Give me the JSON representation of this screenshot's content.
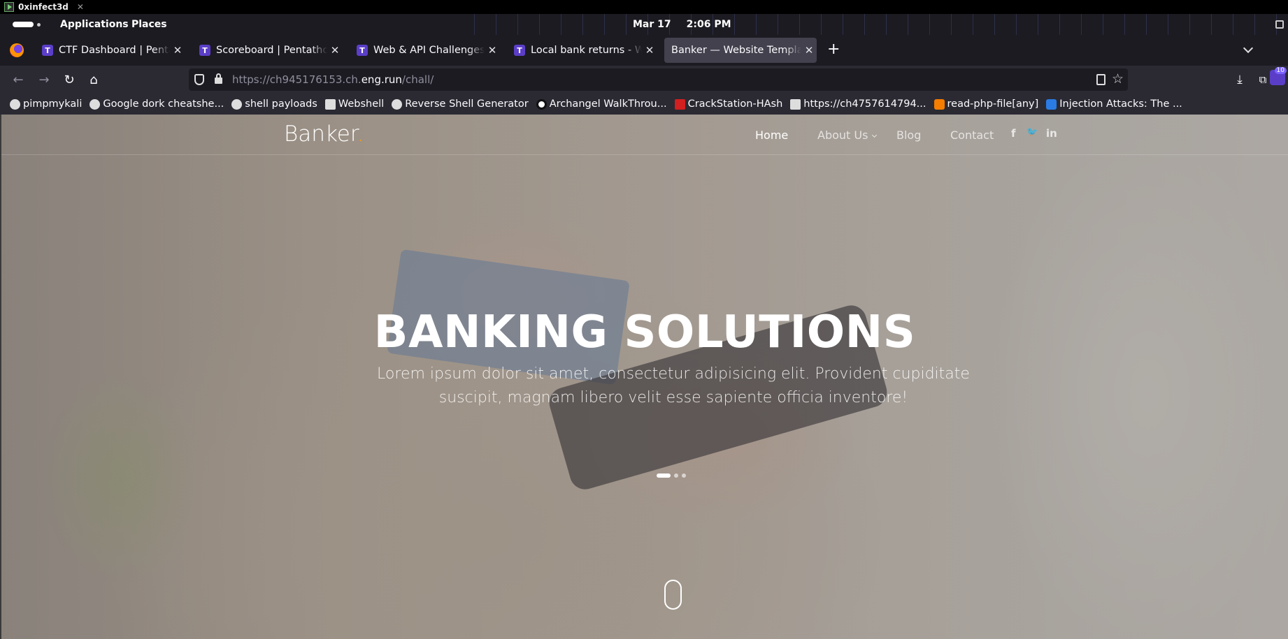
{
  "window": {
    "title": "0xinfect3d",
    "close": "✕"
  },
  "panel": {
    "applications": "Applications",
    "places": "Places",
    "date": "Mar 17",
    "time": "2:06 PM"
  },
  "tabs": [
    {
      "label": "CTF Dashboard | Pentathon",
      "icon": "T"
    },
    {
      "label": "Scoreboard | Pentathon CTF",
      "icon": "T"
    },
    {
      "label": "Web & API Challenges | Pentathon",
      "icon": "T"
    },
    {
      "label": "Local bank returns - Web",
      "icon": "T"
    },
    {
      "label": "Banker — Website Template",
      "icon": ""
    }
  ],
  "tab_close": "✕",
  "new_tab": "+",
  "url": {
    "prefix": "https://ch945176153.ch.",
    "domain": "eng.run",
    "path": "/chall/"
  },
  "extension_badge": "10",
  "bookmarks": [
    {
      "label": "pimpmykali",
      "icon": "github-icon"
    },
    {
      "label": "Google dork cheatshe...",
      "icon": "github-icon"
    },
    {
      "label": "shell payloads",
      "icon": "github-icon"
    },
    {
      "label": "Webshell",
      "icon": "webshell-icon"
    },
    {
      "label": "Reverse Shell Generator",
      "icon": "skull-icon"
    },
    {
      "label": "Archangel WalkThrou...",
      "icon": "medium-icon"
    },
    {
      "label": "CrackStation-HAsh",
      "icon": "crackstation-icon"
    },
    {
      "label": "https://ch4757614794...",
      "icon": "robot-icon"
    },
    {
      "label": "read-php-file[any]",
      "icon": "blogger-icon"
    },
    {
      "label": "Injection Attacks: The ...",
      "icon": "edge-icon"
    }
  ],
  "site": {
    "logo": "Banker",
    "logo_dot": ".",
    "menu": {
      "home": "Home",
      "about": "About Us",
      "blog": "Blog",
      "contact": "Contact"
    },
    "social": {
      "facebook": "f",
      "twitter": "🐦",
      "linkedin": "in"
    },
    "hero_title": "BANKING SOLUTIONS",
    "hero_subtitle": "Lorem ipsum dolor sit amet, consectetur adipisicing elit. Provident cupiditate suscipit, magnam libero velit esse sapiente officia inventore!",
    "slider": {
      "count": 3,
      "active": 1
    }
  },
  "colors": {
    "accent": "#f89d13",
    "browser_bg": "#1c1b22",
    "toolbar_bg": "#2b2a33",
    "active_tab": "#42414d"
  }
}
